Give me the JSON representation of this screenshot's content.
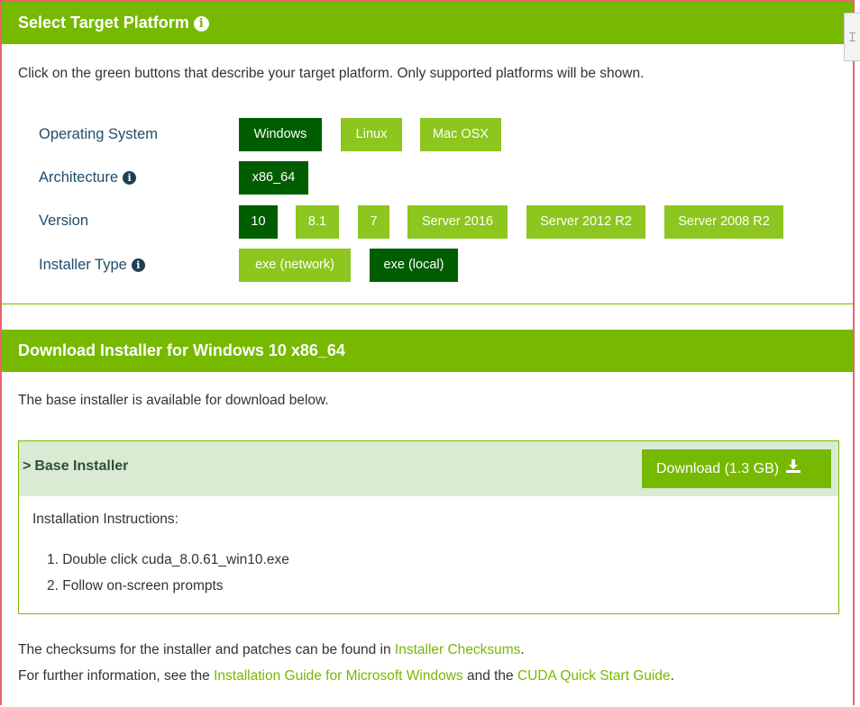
{
  "select_panel": {
    "title": "Select Target Platform",
    "info_glyph": "i",
    "intro": "Click on the green buttons that describe your target platform. Only supported platforms will be shown.",
    "rows": {
      "os": {
        "label": "Operating System",
        "options": [
          "Windows",
          "Linux",
          "Mac OSX"
        ],
        "selected": "Windows"
      },
      "arch": {
        "label": "Architecture",
        "options": [
          "x86_64"
        ],
        "selected": "x86_64"
      },
      "version": {
        "label": "Version",
        "options": [
          "10",
          "8.1",
          "7",
          "Server 2016",
          "Server 2012 R2",
          "Server 2008 R2"
        ],
        "selected": "10"
      },
      "installer_type": {
        "label": "Installer Type",
        "options": [
          "exe (network)",
          "exe (local)"
        ],
        "selected": "exe (local)"
      }
    }
  },
  "download_panel": {
    "title": "Download Installer for Windows 10 x86_64",
    "intro": "The base installer is available for download below.",
    "installer": {
      "chevron": ">",
      "title": "Base Installer",
      "download_label": "Download (1.3 GB)",
      "download_icon": "download-icon",
      "instructions_title": "Installation Instructions:",
      "steps": [
        "1. Double click cuda_8.0.61_win10.exe",
        "2. Follow on-screen prompts"
      ]
    }
  },
  "footer": {
    "line1_prefix": "The checksums for the installer and patches can be found in ",
    "line1_link": "Installer Checksums",
    "line1_suffix": ".",
    "line2_prefix": "For further information, see the ",
    "line2_link1": "Installation Guide for Microsoft Windows",
    "line2_mid": " and the ",
    "line2_link2": "CUDA Quick Start Guide",
    "line2_suffix": "."
  },
  "colors": {
    "nvidia_green": "#76b900",
    "selected_green": "#005d00",
    "unselected_green": "#8cc61f",
    "label_blue": "#1f4d6b",
    "installer_head_bg": "#daebd3"
  }
}
